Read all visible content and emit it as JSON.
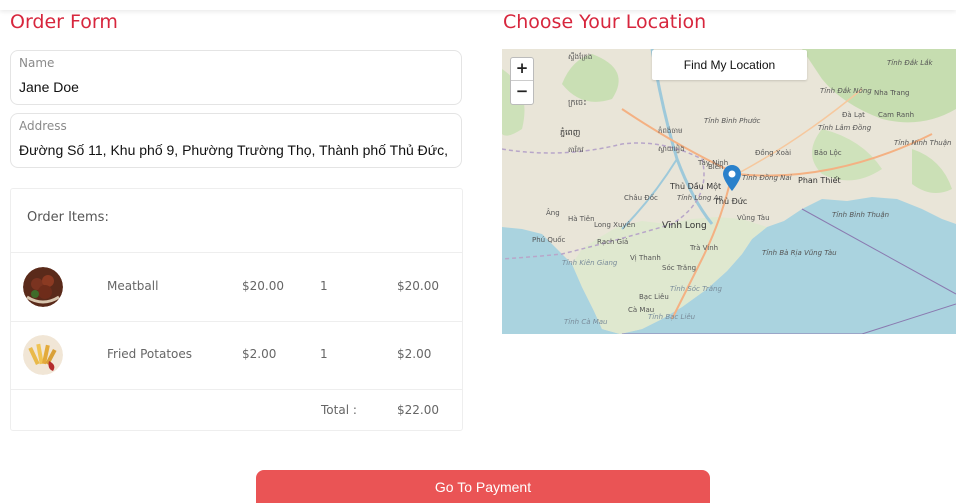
{
  "order_form": {
    "title": "Order Form",
    "name_label": "Name",
    "name_value": "Jane Doe",
    "address_label": "Address",
    "address_value": "Đường Số 11, Khu phố 9, Phường Trường Thọ, Thành phố Thủ Đức,"
  },
  "order_items": {
    "header": "Order Items:",
    "rows": [
      {
        "name": "Meatball",
        "price": "$20.00",
        "qty": "1",
        "subtotal": "$20.00",
        "thumb_icon": "meatball-dish-icon"
      },
      {
        "name": "Fried Potatoes",
        "price": "$2.00",
        "qty": "1",
        "subtotal": "$2.00",
        "thumb_icon": "fried-potatoes-dish-icon"
      }
    ],
    "total_label": "Total :",
    "total_value": "$22.00"
  },
  "location": {
    "title": "Choose Your Location",
    "find_button": "Find My Location",
    "zoom_in": "+",
    "zoom_out": "−",
    "map_labels": {
      "phnom_penh": "ភ្នំពេញ",
      "tay_ninh": "Tây Ninh",
      "binh_phuoc": "Tỉnh Bình Phước",
      "dong_xoai": "Đồng Xoài",
      "bao_loc": "Bảo Lộc",
      "da_lat": "Đà Lạt",
      "cam_ranh": "Cam Ranh",
      "nha_trang": "Nha Trang",
      "tinh_dak_lak": "Tỉnh Đắk Lắk",
      "tinh_dak_nong": "Tỉnh Đắk Nông",
      "tinh_lam_dong": "Tỉnh Lâm Đồng",
      "tinh_ninh_thuan": "Tỉnh Ninh Thuận",
      "phan_thiet": "Phan Thiết",
      "tinh_binh_thuan": "Tỉnh Bình Thuận",
      "thu_dau_mot": "Thủ Dầu Một",
      "thu_duc": "Thủ Đức",
      "tinh_dong_nai": "Tỉnh Đồng Nai",
      "bien": "Biên",
      "vung_tau": "Vũng Tàu",
      "tinh_ba_ria": "Tỉnh Bà Rịa Vũng Tàu",
      "chau_doc": "Châu Đốc",
      "tinh_long_an": "Tỉnh Long An",
      "vinh_long": "Vĩnh Long",
      "long_xuyen": "Long Xuyên",
      "ha_tien": "Hà Tiên",
      "tra_vinh": "Trà Vinh",
      "rach_gia": "Rạch Giá",
      "phu_quoc": "Phú Quốc",
      "vi_thanh": "Vị Thanh",
      "soc_trang": "Sóc Trăng",
      "tinh_kien_giang": "Tỉnh Kiên Giang",
      "bac_lieu": "Bạc Liêu",
      "ca_mau": "Cà Mau",
      "tinh_ca_mau": "Tỉnh Cà Mau",
      "tinh_soc_trang": "Tỉnh Sóc Trăng",
      "tinh_bac_lieu": "Tỉnh Bạc Liêu",
      "kratie": "ក្រចេះ",
      "kampong": "កំពង់ចាម",
      "svay": "ស្វាយរៀង",
      "takeo": "តាកែវ",
      "ang": "Âng",
      "khmer_top": "ស្ទឹងត្រែង"
    },
    "pin_icon": "map-pin-icon"
  },
  "footer": {
    "pay_button": "Go To Payment"
  },
  "colors": {
    "accent": "#d7263d",
    "pay_button": "#ea5455",
    "sea": "#aad3df",
    "land": "#e8e4d8",
    "pin": "#2a81cb"
  }
}
